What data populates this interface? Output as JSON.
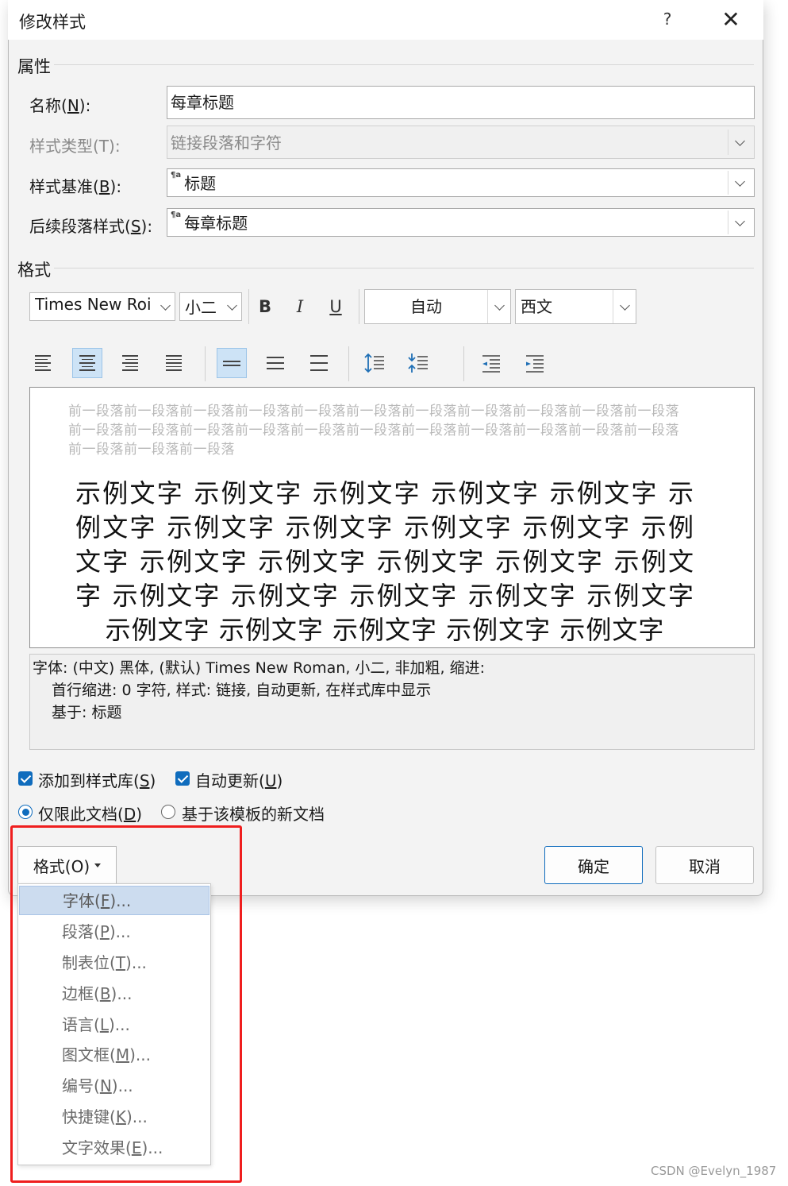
{
  "dialog": {
    "title": "修改样式",
    "help": "?",
    "close": "✕"
  },
  "properties": {
    "section": "属性",
    "name_label": "名称(",
    "name_key": "N",
    "name_label_end": "):",
    "name_value": "每章标题",
    "type_label": "样式类型(T):",
    "type_value": "链接段落和字符",
    "based_label": "样式基准(",
    "based_key": "B",
    "based_label_end": "):",
    "based_mark": "¶a",
    "based_value": "标题",
    "next_label": "后续段落样式(",
    "next_key": "S",
    "next_label_end": "):",
    "next_mark": "¶a",
    "next_value": "每章标题"
  },
  "format": {
    "section": "格式",
    "font": "Times New Roi",
    "size": "小二",
    "bold": "B",
    "italic": "I",
    "underline": "U",
    "color": "自动",
    "script": "西文"
  },
  "preview": {
    "prev_line1": "前一段落前一段落前一段落前一段落前一段落前一段落前一段落前一段落前一段落前一段落前一段落",
    "prev_line2": "前一段落前一段落前一段落前一段落前一段落前一段落前一段落前一段落前一段落前一段落前一段落",
    "prev_line3": "前一段落前一段落前一段落",
    "sample": "示例文字 示例文字 示例文字 示例文字 示例文字 示例文字 示例文字 示例文字 示例文字 示例文字 示例文字 示例文字 示例文字 示例文字 示例文字 示例文字 示例文字 示例文字 示例文字 示例文字 示例文字 示例文字 示例文字 示例文字 示例文字 示例文字"
  },
  "description": {
    "line1": "字体: (中文) 黑体, (默认) Times New Roman, 小二, 非加粗, 缩进:",
    "line2": "首行缩进:  0 字符, 样式: 链接, 自动更新, 在样式库中显示",
    "line3": "基于: 标题"
  },
  "options": {
    "add_gallery": "添加到样式库(",
    "add_gallery_key": "S",
    "add_gallery_end": ")",
    "auto_update": "自动更新(",
    "auto_update_key": "U",
    "auto_update_end": ")",
    "only_doc": "仅限此文档(",
    "only_doc_key": "D",
    "only_doc_end": ")",
    "new_docs": "基于该模板的新文档"
  },
  "buttons": {
    "format": "格式(O)",
    "ok": "确定",
    "cancel": "取消"
  },
  "menu": [
    {
      "label": "字体(",
      "key": "F",
      "end": ")..."
    },
    {
      "label": "段落(",
      "key": "P",
      "end": ")..."
    },
    {
      "label": "制表位(",
      "key": "T",
      "end": ")..."
    },
    {
      "label": "边框(",
      "key": "B",
      "end": ")..."
    },
    {
      "label": "语言(",
      "key": "L",
      "end": ")..."
    },
    {
      "label": "图文框(",
      "key": "M",
      "end": ")..."
    },
    {
      "label": "编号(",
      "key": "N",
      "end": ")..."
    },
    {
      "label": "快捷键(",
      "key": "K",
      "end": ")..."
    },
    {
      "label": "文字效果(",
      "key": "E",
      "end": ")..."
    }
  ],
  "watermark": "CSDN @Evelyn_1987",
  "colors": {
    "accent": "#0f6cbd",
    "highlight_frame": "#ef1e1e",
    "menu_highlight": "#ccdcef"
  }
}
